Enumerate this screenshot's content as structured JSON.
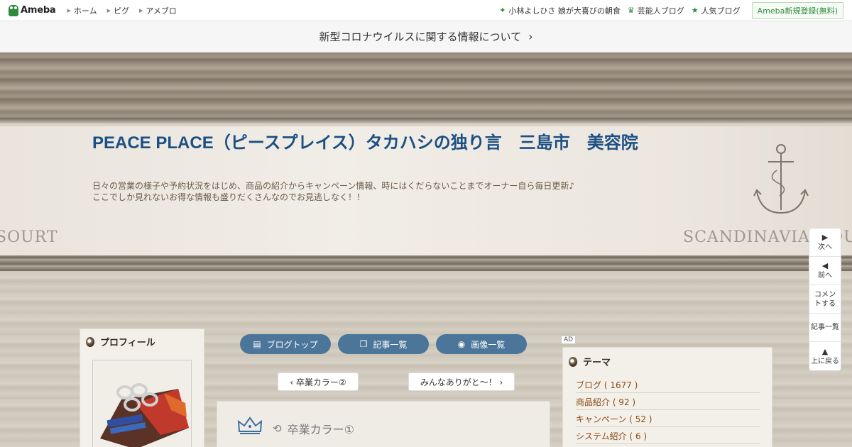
{
  "topbar": {
    "logo": "Ameba",
    "nav": [
      "ホーム",
      "ピグ",
      "アメブロ"
    ],
    "right_links": [
      {
        "icon": "sparkle-icon",
        "glyph": "✦",
        "label": "小林よしひさ 娘が大喜びの朝食"
      },
      {
        "icon": "crown-icon",
        "glyph": "♛",
        "label": "芸能人ブログ"
      },
      {
        "icon": "star-icon",
        "glyph": "★",
        "label": "人気ブログ"
      }
    ],
    "register": "Ameba新規登録(無料)"
  },
  "notice": {
    "text": "新型コロナウイルスに関する情報について",
    "chevron": "›"
  },
  "header": {
    "title": "PEACE PLACE（ピースプレイス）タカハシの独り言　三島市　美容院",
    "description_line1": "日々の営業の様子や予約状況をはじめ、商品の紹介からキャンペーン情報、時にはくだらないことまでオーナー自ら毎日更新♪",
    "description_line2": "ここでしか見れないお得な情報も盛りだくさんなのでお見逃しなく！！",
    "deco_left": "SOURT",
    "deco_right": "SCANDINAVIAN OU"
  },
  "profile": {
    "title": "プロフィール"
  },
  "nav_buttons": [
    {
      "label": "ブログトップ",
      "icon": "document-icon",
      "glyph": "▤"
    },
    {
      "label": "記事一覧",
      "icon": "copy-icon",
      "glyph": "❐"
    },
    {
      "label": "画像一覧",
      "icon": "camera-icon",
      "glyph": "◉"
    }
  ],
  "pager": {
    "prev": "‹ 卒業カラー②",
    "next": "みんなありがと〜！ ›"
  },
  "article": {
    "title": "卒業カラー①",
    "reblog_glyph": "⟲"
  },
  "ad_label": "AD",
  "theme": {
    "title": "テーマ",
    "items": [
      "ブログ ( 1677 )",
      "商品紹介 ( 92 )",
      "キャンペーン ( 52 )",
      "システム紹介 ( 6 )"
    ]
  },
  "sidenav": [
    {
      "glyph": "▶",
      "label": "次へ"
    },
    {
      "glyph": "◀",
      "label": "前へ"
    },
    {
      "glyph": "",
      "label": "コメントする"
    },
    {
      "glyph": "",
      "label": "記事一覧"
    },
    {
      "glyph": "▲",
      "label": "上に戻る"
    }
  ]
}
